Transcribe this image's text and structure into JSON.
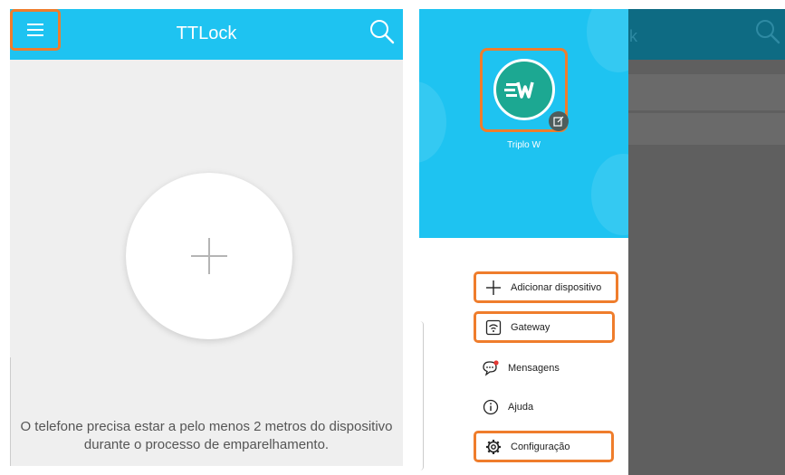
{
  "left": {
    "title": "TTLock",
    "hint": "O telefone precisa estar a pelo menos 2 metros do dispositivo durante o processo de emparelhamento.",
    "icons": {
      "menu": "hamburger-menu-icon",
      "search": "search-icon",
      "add": "plus-icon"
    }
  },
  "right": {
    "background_title_fragment": "k",
    "drawer": {
      "username": "Triplo W",
      "avatar_logo": "EW",
      "items": [
        {
          "label": "Adicionar dispositivo",
          "icon": "plus-icon",
          "highlighted": true
        },
        {
          "label": "Gateway",
          "icon": "wifi-gateway-icon",
          "highlighted": true
        },
        {
          "label": "Mensagens",
          "icon": "chat-bubble-icon",
          "highlighted": false
        },
        {
          "label": "Ajuda",
          "icon": "info-circle-icon",
          "highlighted": false
        },
        {
          "label": "Configuração",
          "icon": "gear-icon",
          "highlighted": true
        }
      ]
    }
  },
  "colors": {
    "accent": "#1ec3f1",
    "highlight": "#ef7d2c",
    "avatar_bg": "#1ca892"
  }
}
